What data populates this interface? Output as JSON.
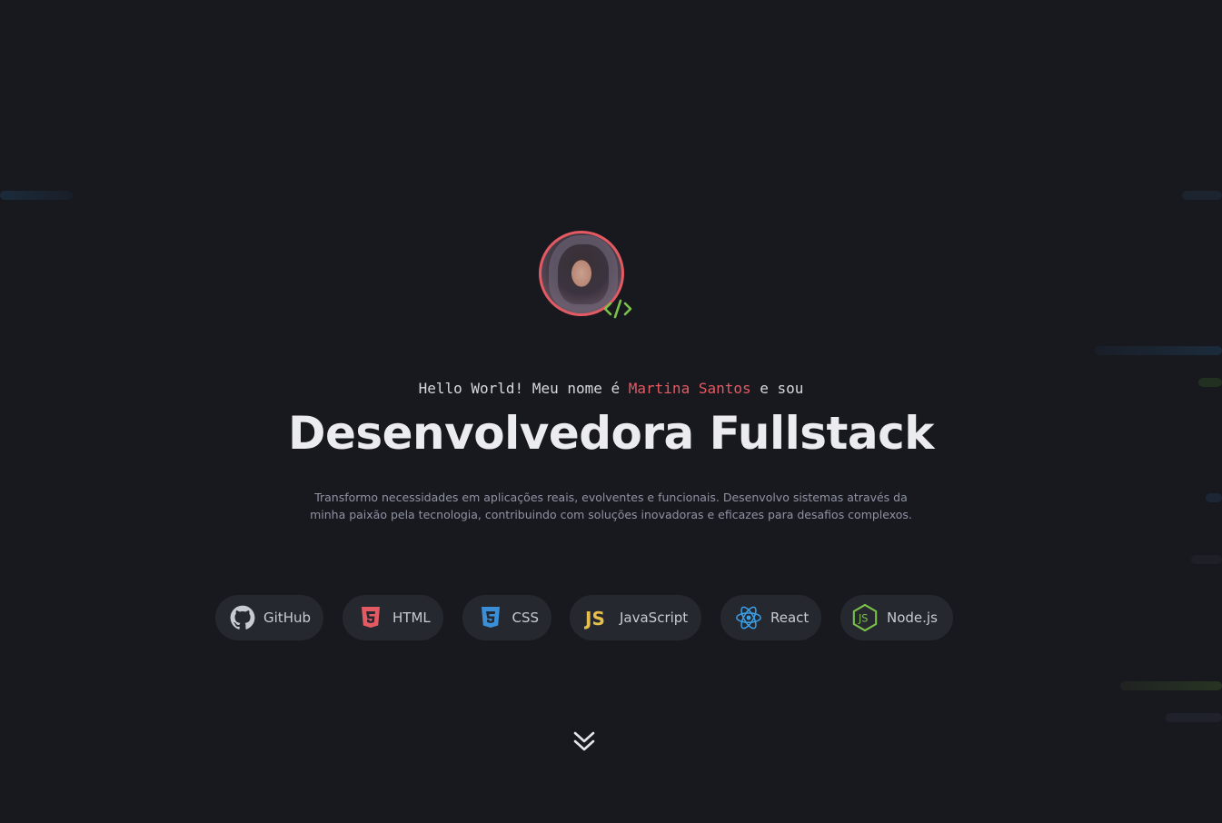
{
  "hero": {
    "intro_prefix": "Hello World! Meu nome é ",
    "intro_name": "Martina Santos",
    "intro_suffix": " e sou",
    "headline": "Desenvolvedora Fullstack",
    "description_line1": "Transformo necessidades em aplicações reais, evolventes e funcionais. Desenvolvo sistemas através da",
    "description_line2": "minha paixão pela tecnologia, contribuindo com soluções inovadoras e eficazes para desafios complexos."
  },
  "avatar": {
    "ring_color": "#e35a63",
    "badge_icon": "code-icon",
    "badge_color": "#7cc24a"
  },
  "skills": [
    {
      "label": "GitHub",
      "icon": "github-icon"
    },
    {
      "label": "HTML",
      "icon": "html5-icon",
      "color": "#e35a63"
    },
    {
      "label": "CSS",
      "icon": "css3-icon",
      "color": "#3a8fd8"
    },
    {
      "label": "JavaScript",
      "icon": "js-icon",
      "color": "#e8bf4a"
    },
    {
      "label": "React",
      "icon": "react-icon",
      "color": "#3aa0e8"
    },
    {
      "label": "Node.js",
      "icon": "nodejs-icon",
      "color": "#7cc24a"
    }
  ],
  "scroll_icon": "double-chevron-down-icon",
  "colors": {
    "background": "#18191f",
    "accent": "#e35a63",
    "chip_background": "#262830"
  }
}
